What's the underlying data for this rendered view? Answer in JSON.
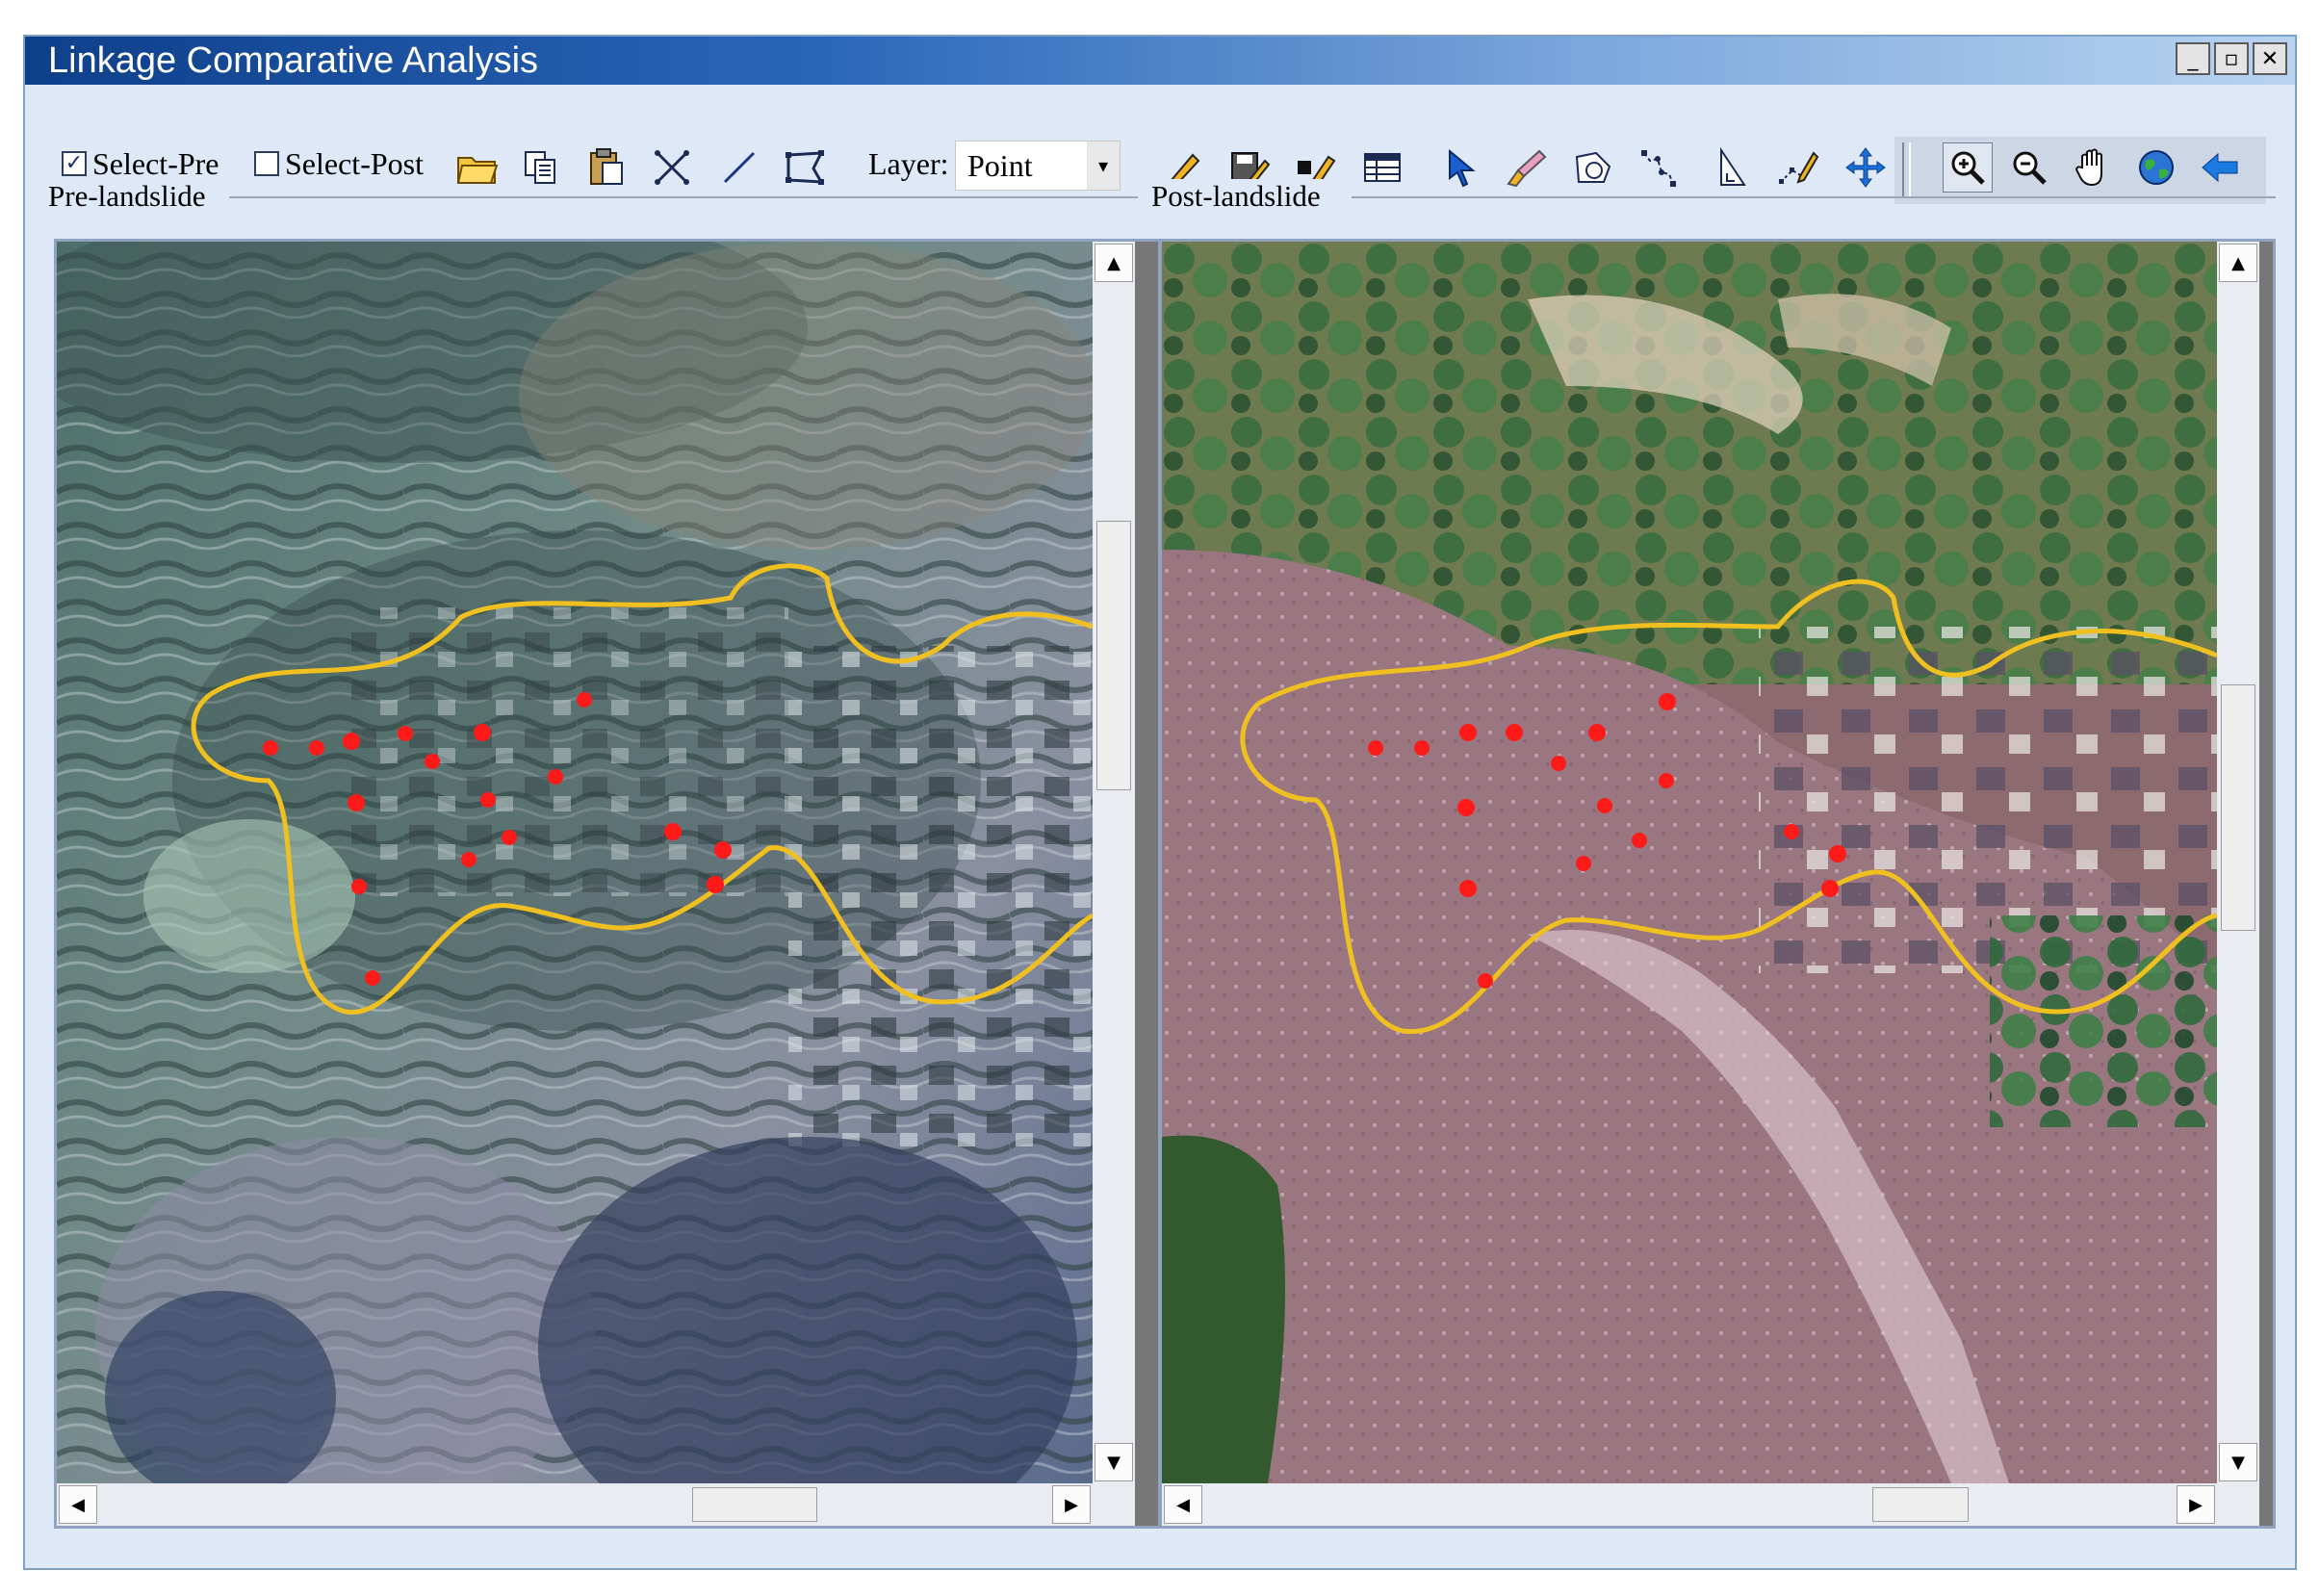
{
  "window": {
    "title": "Linkage Comparative Analysis"
  },
  "window_controls": {
    "minimize": "_",
    "restore": "▫",
    "close": "✕"
  },
  "toolbar": {
    "select_pre": {
      "label": "Select-Pre",
      "checked": true
    },
    "select_post": {
      "label": "Select-Post",
      "checked": false
    },
    "layer_label": "Layer:",
    "layer_value": "Point",
    "icons": [
      "open-folder-icon",
      "copy-icon",
      "paste-icon",
      "intersect-icon",
      "line-icon",
      "polygon-icon",
      "pencil-icon",
      "save-edit-icon",
      "edit-attribute-icon",
      "table-icon",
      "select-arrow-icon",
      "brush-icon",
      "buffer-icon",
      "route-icon",
      "measure-icon",
      "vertex-edit-icon",
      "pan-move-icon",
      "zoom-in-icon",
      "zoom-out-icon",
      "hand-pan-icon",
      "globe-icon",
      "back-arrow-icon"
    ]
  },
  "panes": {
    "pre": {
      "label": "Pre-landslide"
    },
    "post": {
      "label": "Post-landslide"
    }
  },
  "colors": {
    "boundary": "#f0c020",
    "points": "#ff1a1a",
    "title_bar": "#2a66b8"
  }
}
